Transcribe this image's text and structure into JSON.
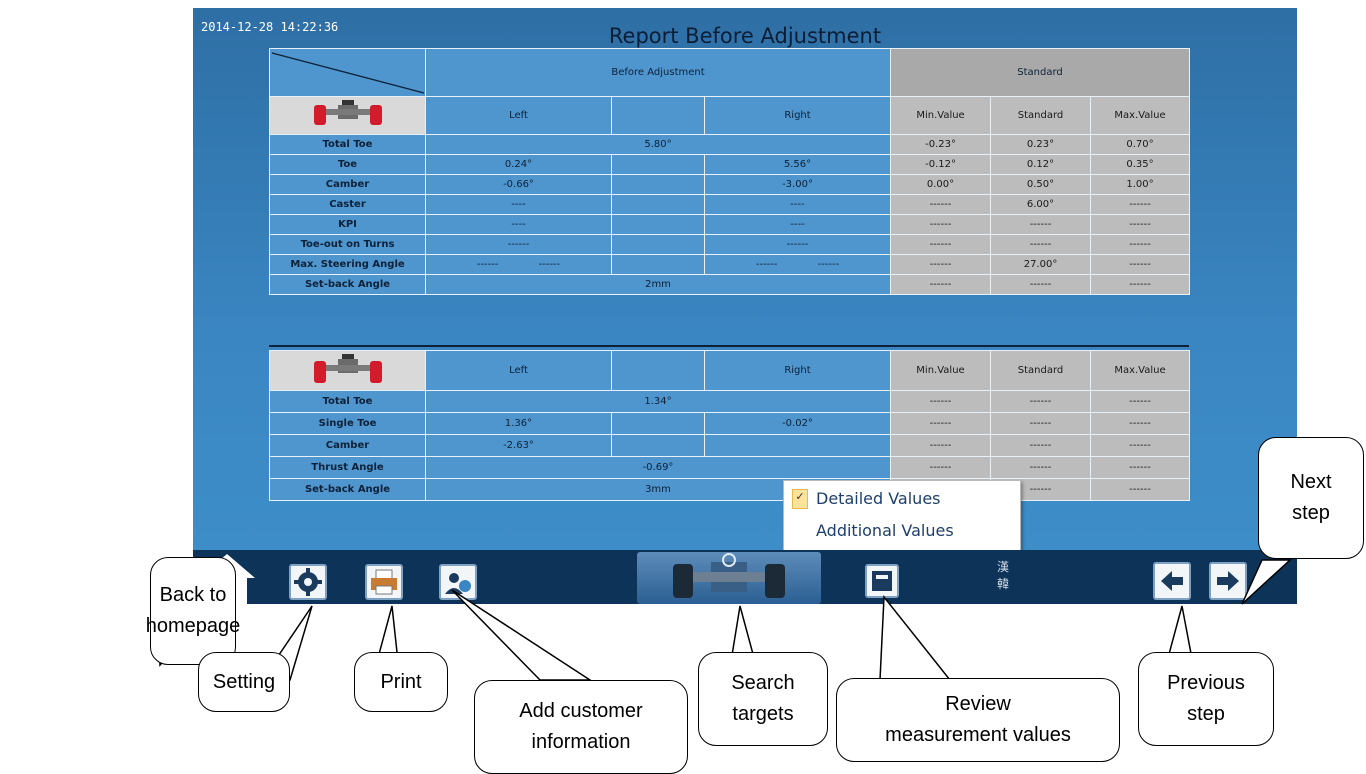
{
  "header": {
    "timestamp": "2014-12-28 14:22:36",
    "title": "Report Before Adjustment"
  },
  "groups": {
    "before": "Before Adjustment",
    "standard": "Standard"
  },
  "columns": {
    "left": "Left",
    "right": "Right",
    "min": "Min.Value",
    "standard": "Standard",
    "max": "Max.Value"
  },
  "front_rows": [
    {
      "label": "Total Toe",
      "merged": "5.80°",
      "min": "-0.23°",
      "std": "0.23°",
      "max": "0.70°"
    },
    {
      "label": "Toe",
      "left": "0.24°",
      "right": "5.56°",
      "min": "-0.12°",
      "std": "0.12°",
      "max": "0.35°"
    },
    {
      "label": "Camber",
      "left": "-0.66°",
      "right": "-3.00°",
      "min": "0.00°",
      "std": "0.50°",
      "max": "1.00°"
    },
    {
      "label": "Caster",
      "left": "----",
      "right": "----",
      "min": "------",
      "std": "6.00°",
      "max": "------"
    },
    {
      "label": "KPI",
      "left": "----",
      "right": "----",
      "min": "------",
      "std": "------",
      "max": "------"
    },
    {
      "label": "Toe-out on Turns",
      "left": "------",
      "right": "------",
      "min": "------",
      "std": "------",
      "max": "------"
    },
    {
      "label": "Max. Steering Angle",
      "left_a": "------",
      "left_b": "------",
      "right_a": "------",
      "right_b": "------",
      "min": "------",
      "std": "27.00°",
      "max": "------"
    },
    {
      "label": "Set-back Angle",
      "merged": "2mm",
      "min": "------",
      "std": "------",
      "max": "------"
    }
  ],
  "rear_rows": [
    {
      "label": "Total Toe",
      "merged": "1.34°",
      "min": "------",
      "std": "------",
      "max": "------"
    },
    {
      "label": "Single Toe",
      "left": "1.36°",
      "right": "-0.02°",
      "min": "------",
      "std": "------",
      "max": "------"
    },
    {
      "label": "Camber",
      "left": "-2.63°",
      "right": "",
      "min": "------",
      "std": "------",
      "max": "------"
    },
    {
      "label": "Thrust Angle",
      "merged": "-0.69°",
      "min": "------",
      "std": "------",
      "max": "------"
    },
    {
      "label": "Set-back Angle",
      "merged": "3mm",
      "min": "------",
      "std": "------",
      "max": "------"
    }
  ],
  "menu": {
    "check": "✓",
    "detailed": "Detailed Values",
    "additional": "Additional Values"
  },
  "toolbar": {
    "lang": "漢\n韓"
  },
  "callouts": {
    "home": "Back to\nhomepage",
    "setting": "Setting",
    "print": "Print",
    "customer": "Add customer\ninformation",
    "search": "Search\ntargets",
    "review": "Review\nmeasurement values",
    "previous": "Previous\nstep",
    "next": "Next\nstep"
  },
  "colors": {
    "screen_blue": "#3a86c2",
    "cell_blue": "#4f95ce",
    "cell_gray": "#bcbcbc",
    "toolbar": "#0e3358",
    "value_red": "#d21b2b",
    "value_green": "#1d7a2b"
  },
  "icons": [
    "home-icon",
    "gear-icon",
    "printer-icon",
    "customer-icon",
    "car-icon",
    "review-icon",
    "arrow-left-icon",
    "arrow-right-icon"
  ]
}
